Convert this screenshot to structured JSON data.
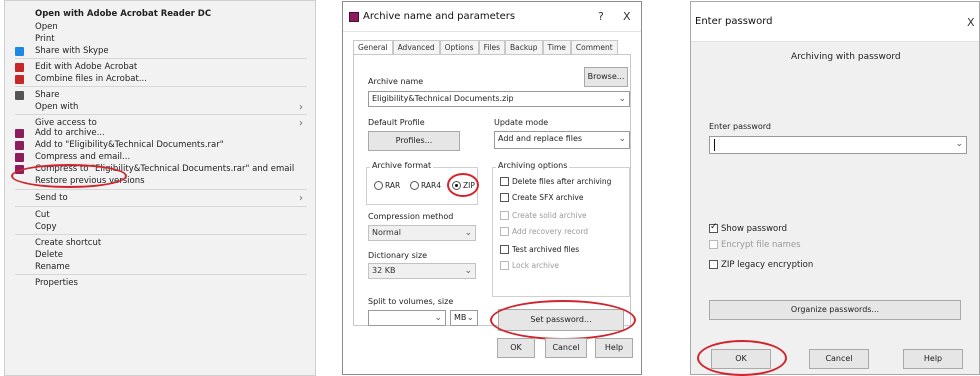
{
  "context_menu": {
    "items": [
      {
        "label": "Open with Adobe Acrobat Reader DC",
        "bold": true,
        "icon": "",
        "arrow": false
      },
      {
        "label": "Open",
        "icon": "",
        "arrow": false
      },
      {
        "label": "Print",
        "icon": "",
        "arrow": false
      },
      {
        "label": "Share with Skype",
        "icon": "skype-icon",
        "arrow": false
      },
      {
        "label": "Edit with Adobe Acrobat",
        "icon": "acrobat-icon",
        "arrow": false
      },
      {
        "label": "Combine files in Acrobat...",
        "icon": "acrobat-combine-icon",
        "arrow": false
      },
      {
        "label": "Share",
        "icon": "share-icon",
        "arrow": false
      },
      {
        "label": "Open with",
        "icon": "",
        "arrow": true
      },
      {
        "label": "Give access to",
        "icon": "",
        "arrow": true
      },
      {
        "label": "Add to archive...",
        "icon": "winrar-icon",
        "arrow": false
      },
      {
        "label": "Add to \"Eligibility&Technical Documents.rar\"",
        "icon": "winrar-icon",
        "arrow": false
      },
      {
        "label": "Compress and email...",
        "icon": "winrar-icon",
        "arrow": false
      },
      {
        "label": "Compress to \"Eligibility&Technical Documents.rar\" and email",
        "icon": "winrar-icon",
        "arrow": false
      },
      {
        "label": "Restore previous versions",
        "icon": "",
        "arrow": false
      },
      {
        "label": "Send to",
        "icon": "",
        "arrow": true
      },
      {
        "label": "Cut",
        "icon": "",
        "arrow": false
      },
      {
        "label": "Copy",
        "icon": "",
        "arrow": false
      },
      {
        "label": "Create shortcut",
        "icon": "",
        "arrow": false
      },
      {
        "label": "Delete",
        "icon": "",
        "arrow": false
      },
      {
        "label": "Rename",
        "icon": "",
        "arrow": false
      },
      {
        "label": "Properties",
        "icon": "",
        "arrow": false
      }
    ]
  },
  "archive_dialog": {
    "title": "Archive name and parameters",
    "help_glyph": "?",
    "close_glyph": "X",
    "tabs": [
      "General",
      "Advanced",
      "Options",
      "Files",
      "Backup",
      "Time",
      "Comment"
    ],
    "archive_name_label": "Archive name",
    "archive_name_value": "Eligibility&Technical Documents.zip",
    "browse_label": "Browse...",
    "default_profile_label": "Default Profile",
    "profiles_label": "Profiles...",
    "update_mode_label": "Update mode",
    "update_mode_value": "Add and replace files",
    "archive_format_label": "Archive format",
    "formats": [
      {
        "label": "RAR",
        "selected": false
      },
      {
        "label": "RAR4",
        "selected": false
      },
      {
        "label": "ZIP",
        "selected": true
      }
    ],
    "compression_method_label": "Compression method",
    "compression_method_value": "Normal",
    "dictionary_size_label": "Dictionary size",
    "dictionary_size_value": "32 KB",
    "split_label": "Split to volumes, size",
    "split_unit": "MB",
    "archiving_options_label": "Archiving options",
    "options": [
      {
        "label": "Delete files after archiving",
        "checked": false,
        "disabled": false
      },
      {
        "label": "Create SFX archive",
        "checked": false,
        "disabled": false
      },
      {
        "label": "Create solid archive",
        "checked": false,
        "disabled": true
      },
      {
        "label": "Add recovery record",
        "checked": false,
        "disabled": true
      },
      {
        "label": "Test archived files",
        "checked": false,
        "disabled": false
      },
      {
        "label": "Lock archive",
        "checked": false,
        "disabled": true
      }
    ],
    "set_password_label": "Set password...",
    "ok_label": "OK",
    "cancel_label": "Cancel",
    "help_label": "Help"
  },
  "password_dialog": {
    "title": "Enter password",
    "close_glyph": "X",
    "heading": "Archiving with password",
    "enter_password_label": "Enter password",
    "password_value": "",
    "options": [
      {
        "label": "Show password",
        "checked": true,
        "disabled": false
      },
      {
        "label": "Encrypt file names",
        "checked": false,
        "disabled": true
      },
      {
        "label": "ZIP legacy encryption",
        "checked": false,
        "disabled": false
      }
    ],
    "organize_label": "Organize passwords...",
    "ok_label": "OK",
    "cancel_label": "Cancel",
    "help_label": "Help"
  },
  "colors": {
    "highlight_oval": "#d2242c",
    "winrar_icon": "#8b1d5e",
    "skype_icon": "#1e88e5",
    "acrobat_icon": "#c62828"
  }
}
